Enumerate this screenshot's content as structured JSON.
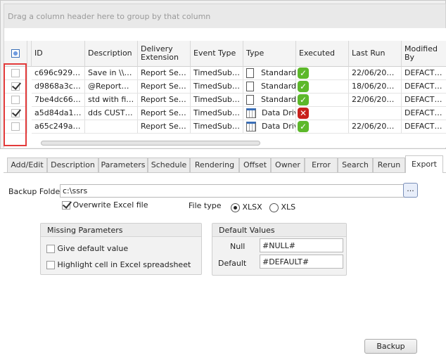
{
  "grid": {
    "group_panel_text": "Drag a column header here to group by that column",
    "columns": [
      "ID",
      "Description",
      "Delivery Extension",
      "Event Type",
      "Type",
      "Executed",
      "Last Run",
      "Modified By"
    ],
    "rows": [
      {
        "checked": false,
        "id": "c696c929-...",
        "description": "Save in \\\\a...",
        "delivery": "Report Ser...",
        "event": "TimedSubs...",
        "type_icon": "document-icon",
        "type": "Standard",
        "executed": true,
        "last_run": "22/06/201...",
        "modified_by": "DEFACTO1..."
      },
      {
        "checked": true,
        "id": "d9868a3c-...",
        "description": "@ReportN...",
        "delivery": "Report Ser...",
        "event": "TimedSubs...",
        "type_icon": "document-icon",
        "type": "Standard",
        "executed": true,
        "last_run": "18/06/201...",
        "modified_by": "DEFACTO1..."
      },
      {
        "checked": false,
        "id": "7be4dc66-...",
        "description": "std with file...",
        "delivery": "Report Ser...",
        "event": "TimedSubs...",
        "type_icon": "document-icon",
        "type": "Standard",
        "executed": true,
        "last_run": "22/06/201...",
        "modified_by": "DEFACTO1..."
      },
      {
        "checked": true,
        "id": "a5d84da1-...",
        "description": "dds CUSTO...",
        "delivery": "Report Ser...",
        "event": "TimedSubs...",
        "type_icon": "table-icon",
        "type": "Data Drive",
        "executed": false,
        "last_run": "",
        "modified_by": "DEFACTO1..."
      },
      {
        "checked": false,
        "id": "a65c249a-...",
        "description": "",
        "delivery": "Report Ser...",
        "event": "TimedSubs...",
        "type_icon": "table-icon",
        "type": "Data Drive",
        "executed": true,
        "last_run": "22/06/201...",
        "modified_by": "DEFACTO1..."
      }
    ]
  },
  "tabs": [
    "Add/Edit",
    "Description",
    "Parameters",
    "Schedule",
    "Rendering",
    "Offset",
    "Owner",
    "Error",
    "Search",
    "Rerun",
    "Export"
  ],
  "active_tab": "Export",
  "export": {
    "backup_folder_label": "Backup Folder",
    "backup_folder_value": "c:\\ssrs",
    "browse_label": "...",
    "overwrite_label": "Overwrite Excel file",
    "overwrite_checked": true,
    "file_type_label": "File type",
    "file_types": [
      "XLSX",
      "XLS"
    ],
    "file_type_selected": "XLSX",
    "missing_params": {
      "title": "Missing Parameters",
      "options": [
        {
          "label": "Give default value",
          "checked": false
        },
        {
          "label": "Highlight cell in Excel spreadsheet",
          "checked": false
        }
      ]
    },
    "default_values": {
      "title": "Default Values",
      "null_label": "Null",
      "null_value": "#NULL#",
      "default_label": "Default",
      "default_value": "#DEFAULT#"
    },
    "backup_button": "Backup"
  },
  "colors": {
    "highlight": "#e33a3a",
    "success": "#5cb82a",
    "error": "#c8201c"
  }
}
